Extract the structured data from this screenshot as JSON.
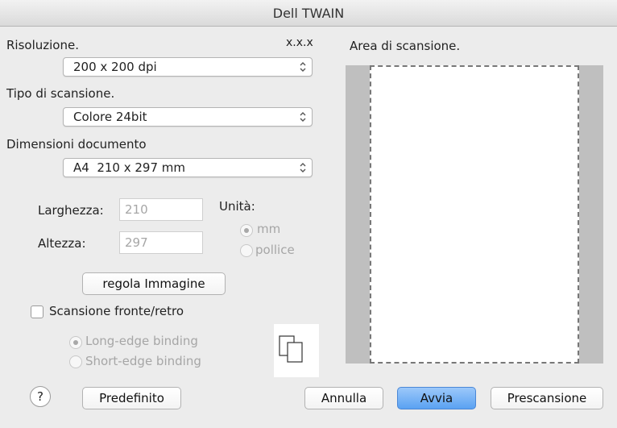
{
  "window": {
    "title": "Dell TWAIN"
  },
  "settings": {
    "resolution_label": "Risoluzione.",
    "version": "x.x.x",
    "resolution_value": "200 x 200 dpi",
    "scan_type_label": "Tipo di scansione.",
    "scan_type_value": "Colore 24bit",
    "doc_size_label": "Dimensioni documento",
    "doc_size_value": "A4  210 x 297 mm",
    "width_label": "Larghezza:",
    "width_value": "210",
    "height_label": "Altezza:",
    "height_value": "297",
    "unit_label": "Unità:",
    "unit_mm": "mm",
    "unit_inch": "pollice",
    "adjust_button": "regola Immagine",
    "duplex_label": "Scansione fronte/retro",
    "long_edge": "Long-edge binding",
    "short_edge": "Short-edge binding"
  },
  "preview": {
    "label": "Area di scansione."
  },
  "footer": {
    "help": "?",
    "defaults": "Predefinito",
    "cancel": "Annulla",
    "start": "Avvia",
    "prescan": "Prescansione"
  },
  "colors": {
    "accent": "#5aa2f2",
    "background": "#ececec",
    "preview_side": "#bfbfbf"
  }
}
